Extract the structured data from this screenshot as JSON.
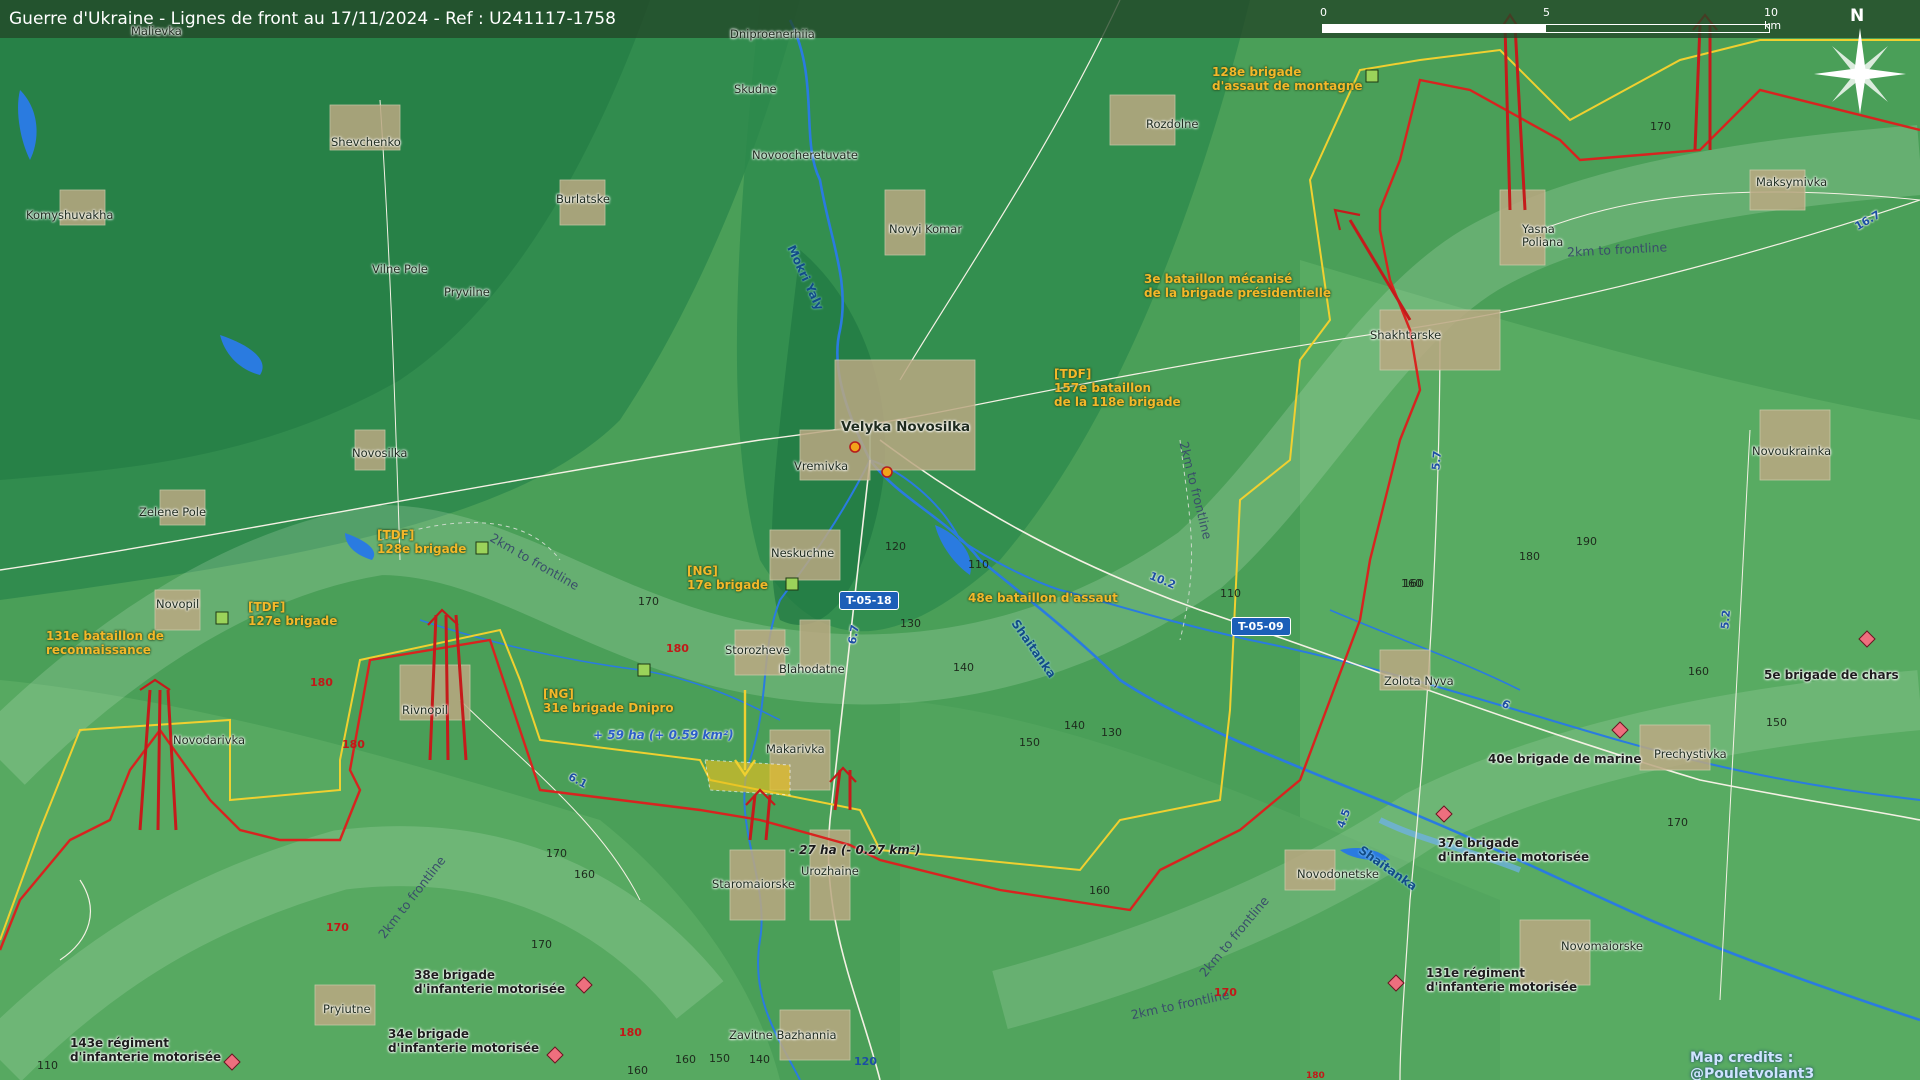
{
  "title": "Guerre d'Ukraine - Lignes de front au 17/11/2024 - Ref : U241117-1758",
  "scale": {
    "ticks": [
      "0",
      "5",
      "10 km"
    ]
  },
  "compass": {
    "label": "N"
  },
  "credits": "Map credits : @Pouletvolant3",
  "colors": {
    "ukr_line": "#f0d030",
    "ru_line": "#d8231f",
    "arrow": "#c51b1b",
    "gain_zone": "#e8c020",
    "river": "#2a7be0",
    "road": "#f4f1e4"
  },
  "towns": {
    "malievka": "Malievka",
    "dniproenerhiia": "Dniproenerhiia",
    "skudne": "Skudne",
    "shevchenko": "Shevchenko",
    "novoocheretuvate": "Novoocheretuvate",
    "burlatske": "Burlatske",
    "komyshuvakha": "Komyshuvakha",
    "novyi_komar": "Novyi Komar",
    "vilne_pole": "Vilne Pole",
    "pryvilne": "Pryvilne",
    "rozdolne": "Rozdolne",
    "maksymivka": "Maksymivka",
    "yasna_poliana": "Yasna\nPoliana",
    "shakhtarske": "Shakhtarske",
    "velyka_novosilka": "Velyka Novosilka",
    "vremivka": "Vremivka",
    "novosilka": "Novosilka",
    "zelene_pole": "Zelene Pole",
    "novoukrainka": "Novoukrainka",
    "neskuchne": "Neskuchne",
    "novopil": "Novopil",
    "storozheve": "Storozheve",
    "blahodatne": "Blahodatne",
    "rivnopil": "Rivnopil",
    "zolota_nyva": "Zolota Nyva",
    "novodarivka": "Novodarivka",
    "makarivka": "Makarivka",
    "prechystivka": "Prechystivka",
    "staromaiorske": "Staromaiorske",
    "urozhaine": "Urozhaine",
    "novodonetske": "Novodonetske",
    "novomaiorske": "Novomaiorske",
    "pryiutne": "Pryiutne",
    "zavitne_bazhannia": "Zavitne Bazhannia"
  },
  "units": {
    "u128_mont": "128e brigade\nd'assaut de montagne",
    "u3_mec": "3e bataillon mécanisé\nde la brigade présidentielle",
    "u157": "[TDF]\n157e bataillon\nde la 118e brigade",
    "u128_tdf": "[TDF]\n128e brigade",
    "u127_tdf": "[TDF]\n127e brigade",
    "u17_ng": "[NG]\n17e brigade",
    "u48": "48e bataillon d'assaut",
    "u131_rec": "131e bataillon de\nreconnaissance",
    "u31_ng": "[NG]\n31e brigade Dnipro",
    "ru_5_chars": "5e brigade de chars",
    "ru_40_marine": "40e brigade de marine",
    "ru_37": "37e brigade\nd'infanterie motorisée",
    "ru_38": "38e brigade\nd'infanterie motorisée",
    "ru_34": "34e brigade\nd'infanterie motorisée",
    "ru_131_reg": "131e régiment\nd'infanterie motorisée",
    "ru_143_reg": "143e régiment\nd'infanterie motorisée"
  },
  "rivers": {
    "mokri_yaly": "Mokri Yaly",
    "shaitanka_1": "Shaitanka",
    "shaitanka_2": "Shaitanka"
  },
  "frontline_buffers": {
    "f1": "2km to frontline",
    "f2": "2km to frontline",
    "f3": "2km to frontline",
    "f4": "2km to frontline",
    "f5": "2km to frontline",
    "f6": "2km to frontline"
  },
  "changes": {
    "gain": "+ 59 ha (+ 0.59 km²)",
    "loss": "- 27 ha (- 0.27 km²)"
  },
  "roads": {
    "t0518": "T-05-18",
    "t0509": "T-05-09",
    "r61": "6.1",
    "r67": "6.7",
    "r102": "10.2",
    "r57": "5.7",
    "r52": "5.2",
    "r45": "4.5",
    "r6": "6",
    "r167": "16.7"
  },
  "altitudes": {
    "a1": "170",
    "a2": "170",
    "a3": "120",
    "a4": "110",
    "a5": "130",
    "a6": "140",
    "a7": "150",
    "a8": "140",
    "a9": "130",
    "a10": "110",
    "a11": "120",
    "a12": "160",
    "a13": "190",
    "a14": "180",
    "a15": "160",
    "a16": "150",
    "a17": "170",
    "a18": "160",
    "a19": "170",
    "a20": "170",
    "a21": "160",
    "a22": "160",
    "a23": "150",
    "a24": "140",
    "a25": "110",
    "a26": "160",
    "a27": "170",
    "a28": "120",
    "a29": "140",
    "a30": "160",
    "r1": "180",
    "r2": "180",
    "r3": "180",
    "r4": "170",
    "r5": "180",
    "r6": "170",
    "r7": "180"
  }
}
